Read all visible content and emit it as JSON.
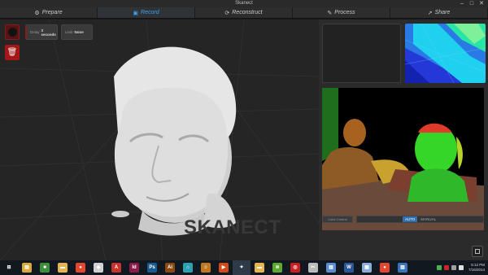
{
  "window": {
    "title": "Skanect",
    "controls": [
      "–",
      "□",
      "✕"
    ]
  },
  "tabs": [
    {
      "label": "Prepare",
      "icon": "⚙",
      "active": false
    },
    {
      "label": "Record",
      "icon": "▣",
      "active": true
    },
    {
      "label": "Reconstruct",
      "icon": "⟳",
      "active": false
    },
    {
      "label": "Process",
      "icon": "✎",
      "active": false
    },
    {
      "label": "Share",
      "icon": "↗",
      "active": false
    }
  ],
  "viewport": {
    "delay_label": "Delay",
    "delay_value": "3 seconds",
    "stop_label": "Limit",
    "stop_value": "None",
    "trash_icon": "🗑",
    "logo": "SKANECT"
  },
  "panel": {
    "color_button": "Color Control",
    "auto_label": "AUTO",
    "manual_label": "MANUAL"
  },
  "taskbar": {
    "apps": [
      {
        "name": "start-icon",
        "glyph": "⊞",
        "color": "#12181f"
      },
      {
        "name": "explorer-icon",
        "glyph": "▤",
        "color": "#d9a93a"
      },
      {
        "name": "store-icon",
        "glyph": "■",
        "color": "#3d8f3d"
      },
      {
        "name": "folder-icon",
        "glyph": "▬",
        "color": "#e3b64f"
      },
      {
        "name": "chrome-icon",
        "glyph": "●",
        "color": "#e4472f"
      },
      {
        "name": "app-icon",
        "glyph": "◆",
        "color": "#d0d0d0"
      },
      {
        "name": "acrobat-icon",
        "glyph": "A",
        "color": "#c8332b"
      },
      {
        "name": "indesign-icon",
        "glyph": "Id",
        "color": "#8a1b4a"
      },
      {
        "name": "photoshop-icon",
        "glyph": "Ps",
        "color": "#1b5a8f"
      },
      {
        "name": "illustrator-icon",
        "glyph": "Ai",
        "color": "#8a4a10"
      },
      {
        "name": "home-icon",
        "glyph": "⌂",
        "color": "#2aa0b0"
      },
      {
        "name": "people-icon",
        "glyph": "☺",
        "color": "#c0781f"
      },
      {
        "name": "video-icon",
        "glyph": "▶",
        "color": "#d04a1a"
      },
      {
        "name": "skanect-icon",
        "glyph": "✦",
        "color": "#2e3a48"
      },
      {
        "name": "folder2-icon",
        "glyph": "▬",
        "color": "#e3b64f"
      },
      {
        "name": "spotify-icon",
        "glyph": "≋",
        "color": "#5fa82f"
      },
      {
        "name": "cc-icon",
        "glyph": "◎",
        "color": "#c82020"
      },
      {
        "name": "tool-icon",
        "glyph": "✂",
        "color": "#bbbbbb"
      },
      {
        "name": "files-icon",
        "glyph": "▤",
        "color": "#5b8bd0"
      },
      {
        "name": "word-icon",
        "glyph": "W",
        "color": "#2b5797"
      },
      {
        "name": "picture-icon",
        "glyph": "▦",
        "color": "#8ab0d8"
      },
      {
        "name": "chrome2-icon",
        "glyph": "●",
        "color": "#e4472f"
      },
      {
        "name": "gallery-icon",
        "glyph": "▨",
        "color": "#3b73b9"
      }
    ],
    "time": "5:12 PM",
    "date": "7/16/2014"
  }
}
